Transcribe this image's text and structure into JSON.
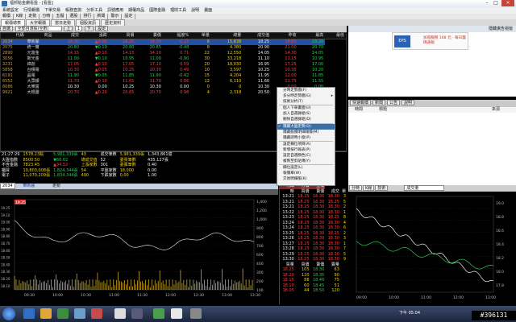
{
  "window": {
    "title": "福邦點金鑽看盤 - [看盤]"
  },
  "menu": [
    "系統設定",
    "行情報價",
    "下單交易",
    "帳務查詢",
    "分析工具",
    "訊號應用",
    "期權商品",
    "國際金融",
    "理財工具",
    "說明",
    "畫面"
  ],
  "toolbar": [
    "報價",
    "K線",
    "走勢",
    "分時",
    "五檔",
    "選股",
    "排行",
    "新聞",
    "警示",
    "設定"
  ],
  "tabs": [
    "報價總表",
    "大字報價",
    "當日走勢",
    "個股資訊",
    "歷史資料"
  ],
  "tabs_active": 0,
  "controls": {
    "group": "自選",
    "list": "全部自選股(全數)",
    "page": "1",
    "b1": "上",
    "b2": "下",
    "b3": "設定"
  },
  "quote": {
    "headers": [
      "代碼",
      "商品",
      "成交",
      "漲跌",
      "買價",
      "賣價",
      "幅度%",
      "單量",
      "總量",
      "成交值",
      "昨收",
      "最高",
      "最低"
    ],
    "rows": [
      [
        "2034",
        "華新麗",
        "18.30",
        "▲0.05",
        "18.25",
        "18.30",
        "0.27",
        "6",
        "15,638",
        "18.25",
        "18.60",
        "18.20"
      ],
      [
        "2075",
        "統一實",
        "20.80",
        "▼0.10",
        "20.80",
        "20.85",
        "-0.48",
        "8",
        "4,380",
        "20.90",
        "21.00",
        "20.70"
      ],
      [
        "2890",
        "元富金",
        "14.15",
        "▲0.10",
        "14.15",
        "14.20",
        "0.71",
        "22",
        "12,550",
        "14.05",
        "14.30",
        "14.05"
      ],
      [
        "3056",
        "新光金",
        "11.00",
        "▼0.10",
        "10.95",
        "11.00",
        "-0.90",
        "30",
        "33,218",
        "11.10",
        "11.15",
        "10.95"
      ],
      [
        "3231",
        "緯創",
        "17.05",
        "▲0.10",
        "17.05",
        "17.10",
        "0.59",
        "20",
        "18,030",
        "16.95",
        "17.25",
        "17.00"
      ],
      [
        "5858",
        "台積電",
        "10.30",
        "▲0.05",
        "10.25",
        "10.30",
        "0.49",
        "10",
        "3,597",
        "10.25",
        "10.35",
        "10.20"
      ],
      [
        "6191",
        "晶電",
        "11.90",
        "▼0.05",
        "11.85",
        "11.90",
        "-0.42",
        "15",
        "4,204",
        "11.95",
        "12.00",
        "11.85"
      ],
      [
        "6552",
        "大眾銀",
        "11.70",
        "▲0.10",
        "11.65",
        "11.70",
        "0.86",
        "12",
        "6,110",
        "11.60",
        "11.75",
        "11.55"
      ],
      [
        "8086",
        "大樂富",
        "10.30",
        "0.00",
        "10.25",
        "10.30",
        "0.00",
        "0",
        "0",
        "10.30",
        "0.00",
        "0.00"
      ],
      [
        "9921",
        "大根團",
        "20.70",
        "▲0.20",
        "20.65",
        "20.70",
        "0.98",
        "4",
        "2,318",
        "20.50",
        "20.80",
        "20.45"
      ]
    ]
  },
  "ad": {
    "header": "隱藏廣告視窗",
    "label": "EPS",
    "text": "加值服務 168 元 · 每日籌碼通報"
  },
  "news": {
    "tabs": [
      "快速報價",
      "新聞",
      "公告",
      "說明"
    ],
    "cols": [
      "時間",
      "標題",
      "來源"
    ]
  },
  "summary": [
    [
      "21:27:29",
      "1578.23點",
      "5,981,339張",
      "43",
      "成交筆數",
      "5,981,339張",
      "1,343,861億"
    ],
    [
      "大盤指數",
      "8500.50",
      "▼60.02",
      "總成交值",
      "52",
      "委買筆數",
      "435,127張"
    ],
    [
      "不含金融",
      "7823.45",
      "▲34.52",
      "上漲家數",
      "301",
      "委賣筆數",
      "0.40"
    ],
    [
      "櫃買",
      "10,803,008張",
      "1,824,344張",
      "54",
      "平盤家數",
      "18,000",
      "0.00"
    ],
    [
      "電子",
      "11,070,209張",
      "1,834,344張",
      "490",
      "下跌家數",
      "0.00",
      "1.00"
    ]
  ],
  "chart": {
    "symbol": "2034",
    "name": "華新麗",
    "tab": "走勢",
    "top": "19.25",
    "prices": [
      "1,400",
      "1,200",
      "1,000",
      "900",
      "800",
      "700",
      "600",
      "400",
      "300",
      "200",
      "100"
    ],
    "times": [
      "09:30",
      "10:00",
      "10:30",
      "11:00",
      "11:30",
      "12:00",
      "12:30",
      "13:00",
      "13:30"
    ],
    "left": [
      "19.25",
      "19.10",
      "19.00",
      "18.90",
      "18.80",
      "18.70",
      "18.60",
      "18.50",
      "18.40",
      "18.30",
      "18.20",
      "18.10"
    ]
  },
  "ticks": {
    "tabs": [
      "明細",
      "分價",
      "五檔"
    ],
    "cols": [
      "時",
      "買價",
      "賣價",
      "成交",
      "單"
    ],
    "rows": [
      [
        "13:21",
        "18.25",
        "18.30",
        "18.30",
        "3"
      ],
      [
        "13:21",
        "18.25",
        "18.30",
        "18.25",
        "5"
      ],
      [
        "13:21",
        "18.25",
        "18.30",
        "18.30",
        "2"
      ],
      [
        "13:22",
        "18.25",
        "18.30",
        "18.30",
        "1"
      ],
      [
        "13:23",
        "18.25",
        "18.30",
        "18.25",
        "8"
      ],
      [
        "13:24",
        "18.25",
        "18.30",
        "18.30",
        "4"
      ],
      [
        "13:24",
        "18.25",
        "18.30",
        "18.30",
        "6"
      ],
      [
        "13:25",
        "18.25",
        "18.30",
        "18.25",
        "2"
      ],
      [
        "13:26",
        "18.25",
        "18.30",
        "18.30",
        "3"
      ],
      [
        "13:27",
        "18.25",
        "18.30",
        "18.30",
        "1"
      ],
      [
        "13:28",
        "18.25",
        "18.30",
        "18.30",
        "7"
      ],
      [
        "13:29",
        "18.25",
        "18.30",
        "18.30",
        "5"
      ],
      [
        "13:30",
        "18.25",
        "18.30",
        "18.30",
        "9"
      ]
    ],
    "book_cols": [
      "買量",
      "買價",
      "賣價",
      "賣量"
    ],
    "book": [
      [
        "18.25",
        "105",
        "18.30",
        "63"
      ],
      [
        "18.20",
        "120",
        "18.35",
        "90"
      ],
      [
        "18.15",
        "88",
        "18.40",
        "75"
      ],
      [
        "18.10",
        "60",
        "18.45",
        "51"
      ],
      [
        "18.05",
        "44",
        "18.50",
        "120"
      ]
    ]
  },
  "rchart": {
    "tabs": [
      "分時",
      "K線",
      "技術"
    ],
    "field": "成交量",
    "times": [
      "09:00",
      "10:00",
      "11:00",
      "12:00",
      "13:00"
    ],
    "prices": [
      "19.0",
      "18.8",
      "18.6",
      "18.4",
      "18.2",
      "18.0",
      "17.8"
    ]
  },
  "context_menu": [
    {
      "t": "分時走勢圖(F)",
      "sep": false
    },
    {
      "t": "多分時走勢圖(G)",
      "sep": false,
      "arrow": true
    },
    {
      "t": "技術分析(T)",
      "sep": true
    },
    {
      "t": "個人下單畫面(U)",
      "sep": false
    },
    {
      "t": "加入自選群組(S)",
      "sep": false
    },
    {
      "t": "刪除自選群組(D)",
      "sep": true
    },
    {
      "t": "隱藏大盤走勢(Q)",
      "sep": false,
      "check": true,
      "hl": true
    },
    {
      "t": "隱藏股價明細報價(M)",
      "sep": false
    },
    {
      "t": "隱藏即時小窗(P)",
      "sep": true
    },
    {
      "t": "設定欄位項目(A)",
      "sep": false
    },
    {
      "t": "新增排行報表(P)",
      "sep": false
    },
    {
      "t": "設定自選顏色(C)",
      "sep": false
    },
    {
      "t": "複製至剪貼簿(Y)",
      "sep": true
    },
    {
      "t": "欄位設定(L)",
      "sep": false
    },
    {
      "t": "報價單(W)",
      "sep": false
    },
    {
      "t": "交易明細帳(K)",
      "sep": false
    }
  ],
  "status": {
    "time": "下午 05:04",
    "page": "1/1",
    "code": "#396131"
  },
  "colors": {
    "up": "#ff3b3b",
    "down": "#1fd14a",
    "bg": "#000000",
    "sel": "#2451a8"
  }
}
